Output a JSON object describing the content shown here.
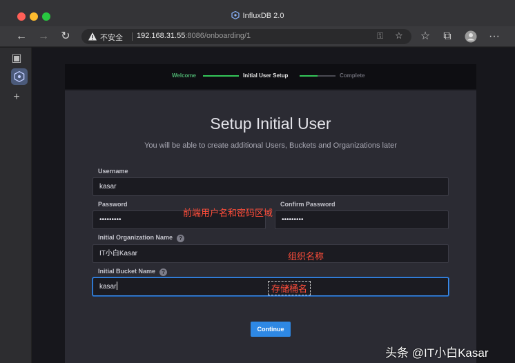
{
  "window": {
    "title": "InfluxDB 2.0"
  },
  "toolbar": {
    "insecure_label": "不安全",
    "url_host": "192.168.31.55",
    "url_rest": ":8086/onboarding/1"
  },
  "stepper": {
    "steps": [
      "Welcome",
      "Initial User Setup",
      "Complete"
    ]
  },
  "form": {
    "title": "Setup Initial User",
    "subtitle": "You will be able to create additional Users, Buckets and Organizations later",
    "username_label": "Username",
    "username_value": "kasar",
    "password_label": "Password",
    "password_value": "•••••••••",
    "confirm_label": "Confirm Password",
    "confirm_value": "•••••••••",
    "org_label": "Initial Organization Name",
    "org_value": "IT小白Kasar",
    "bucket_label": "Initial Bucket Name",
    "bucket_value": "kasar",
    "continue_label": "Continue"
  },
  "annotations": {
    "credentials": "前端用户名和密码区域",
    "organization": "组织名称",
    "bucket": "存储桶名"
  },
  "watermark": "头条 @IT小白Kasar",
  "colors": {
    "accent": "#2e88e4",
    "step_done": "#34c759",
    "annotation": "#ff4d3a"
  }
}
